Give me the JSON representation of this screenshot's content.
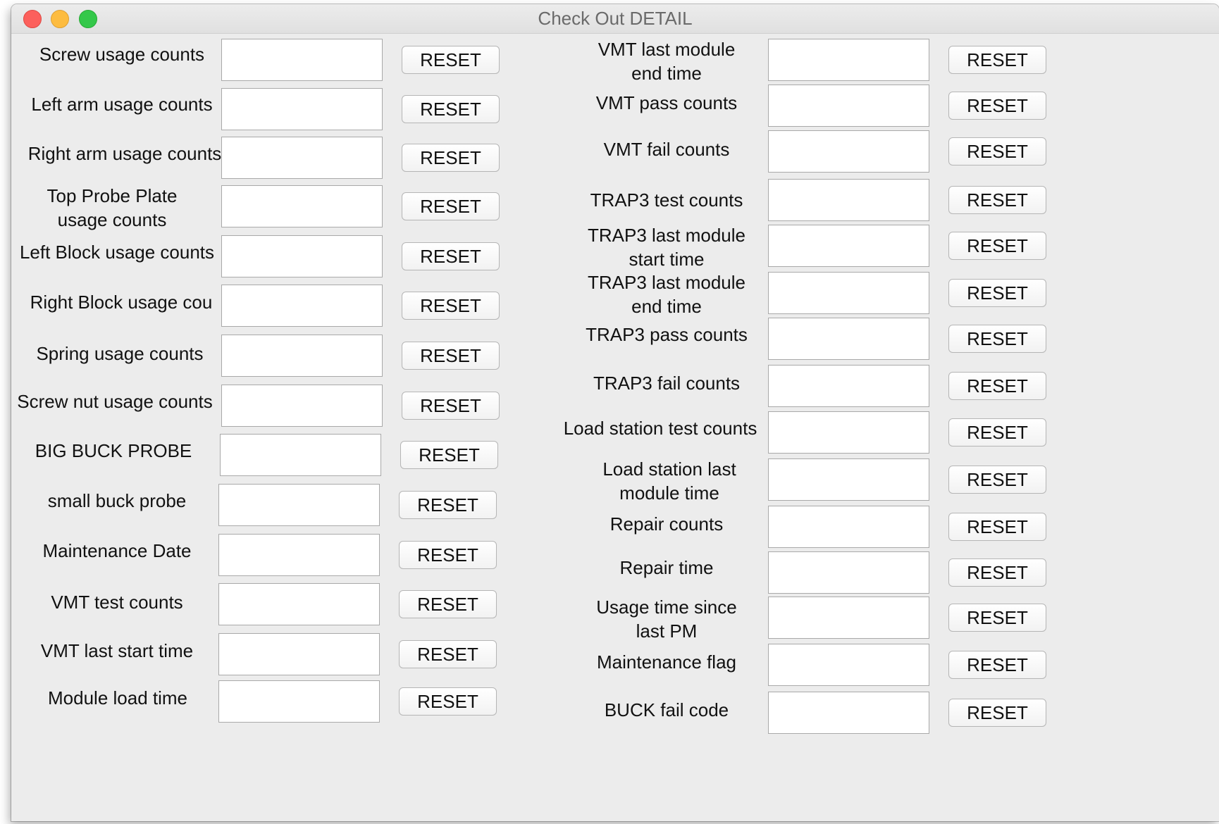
{
  "window": {
    "title": "Check Out DETAIL"
  },
  "reset_label": "RESET",
  "left_rows": [
    {
      "label": "Screw usage counts",
      "value": ""
    },
    {
      "label": "Left arm usage counts",
      "value": ""
    },
    {
      "label": "Right arm usage counts",
      "value": ""
    },
    {
      "label": "Top Probe Plate\nusage counts",
      "value": ""
    },
    {
      "label": "Left Block usage counts",
      "value": ""
    },
    {
      "label": "Right Block usage cou",
      "value": ""
    },
    {
      "label": "Spring usage counts",
      "value": ""
    },
    {
      "label": "Screw nut usage counts",
      "value": ""
    },
    {
      "label": "BIG BUCK PROBE",
      "value": ""
    },
    {
      "label": "small buck probe",
      "value": ""
    },
    {
      "label": "Maintenance Date",
      "value": ""
    },
    {
      "label": "VMT test counts",
      "value": ""
    },
    {
      "label": "VMT last start time",
      "value": ""
    },
    {
      "label": "Module load time",
      "value": ""
    }
  ],
  "right_rows": [
    {
      "label": "VMT last module\nend time",
      "value": ""
    },
    {
      "label": "VMT pass counts",
      "value": ""
    },
    {
      "label": "VMT fail counts",
      "value": ""
    },
    {
      "label": "TRAP3 test counts",
      "value": ""
    },
    {
      "label": "TRAP3 last module\nstart time",
      "value": ""
    },
    {
      "label": "TRAP3 last module\nend time",
      "value": ""
    },
    {
      "label": "TRAP3 pass counts",
      "value": ""
    },
    {
      "label": "TRAP3 fail counts",
      "value": ""
    },
    {
      "label": "Load station test counts",
      "value": ""
    },
    {
      "label": "Load station last\nmodule time",
      "value": ""
    },
    {
      "label": "Repair counts",
      "value": ""
    },
    {
      "label": "Repair time",
      "value": ""
    },
    {
      "label": "Usage time since\nlast PM",
      "value": ""
    },
    {
      "label": "Maintenance flag",
      "value": ""
    },
    {
      "label": "BUCK fail code",
      "value": ""
    }
  ]
}
